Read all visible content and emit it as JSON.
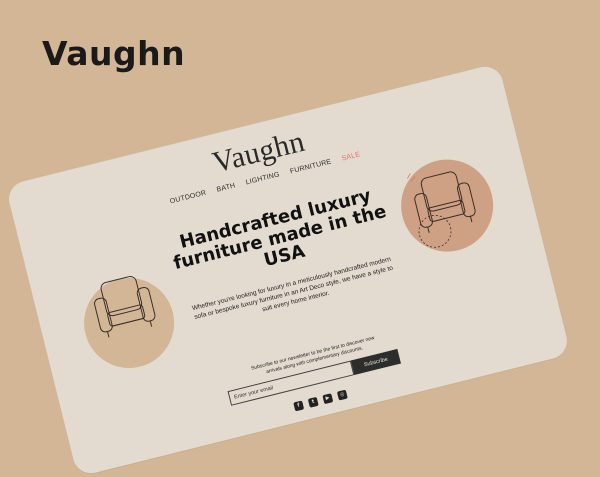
{
  "brand": "Vaughn",
  "site": {
    "logo": "Vaughn",
    "nav": [
      "OUTDOOR",
      "BATH",
      "LIGHTING",
      "FURNITURE",
      "SALE"
    ],
    "headline": "Handcrafted luxury furniture made in the USA",
    "description": "Whether you're looking for luxury in a meticulously handcrafted modern sofa or bespoke luxury furniture in an Art Deco style, we have a style to suit every home interior.",
    "newsletter_text": "Subscribe to our newsletter to be the first to discover new arrivals along with complementary discounts.",
    "email_placeholder": "Enter your email",
    "subscribe_label": "Subscribe",
    "social_icons": [
      "facebook-icon",
      "twitter-icon",
      "youtube-icon",
      "instagram-icon"
    ]
  },
  "colors": {
    "background": "#d2b696",
    "card": "#e3dbd0",
    "accent_sale": "#e0706a",
    "button": "#2d2d2d"
  }
}
